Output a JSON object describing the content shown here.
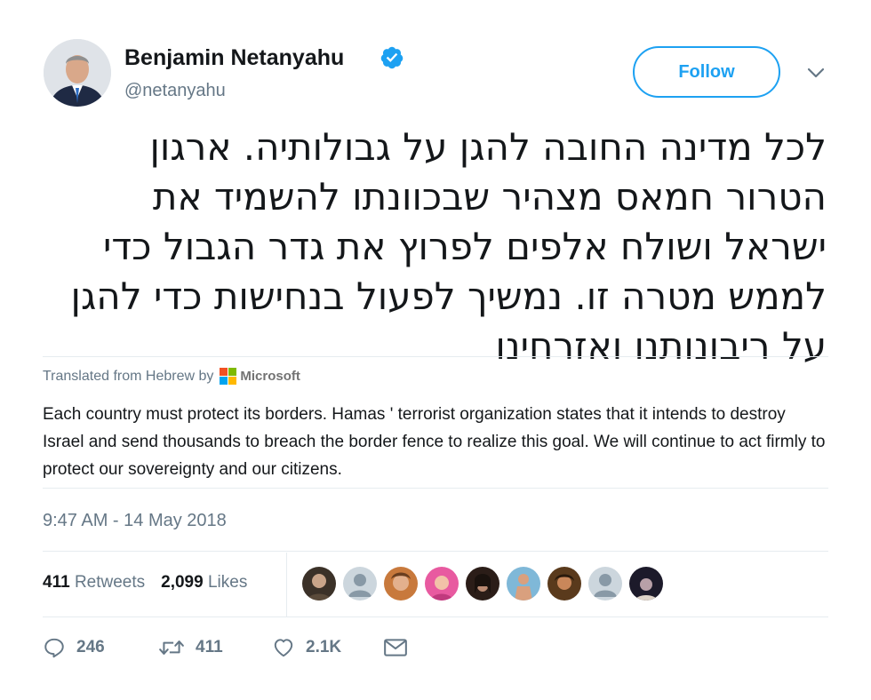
{
  "user": {
    "name": "Benjamin Netanyahu",
    "handle": "@netanyahu",
    "verified": true
  },
  "follow_label": "Follow",
  "tweet": {
    "hebrew_text": "לכל מדינה החובה להגן על גבולותיה. ארגון הטרור חמאס מצהיר שבכוונתו להשמיד את ישראל ושולח אלפים לפרוץ את גדר הגבול כדי לממש מטרה זו. נמשיך לפעול בנחישות כדי להגן על ריבונותנו ואזרחינו",
    "translated_from": "Translated from Hebrew by",
    "translator": "Microsoft",
    "translation": "Each country must protect its borders. Hamas ' terrorist organization states that it intends to destroy Israel and send thousands to breach the border fence to realize this goal. We will continue to act firmly to protect our sovereignty and our citizens.",
    "timestamp": "9:47 AM - 14 May 2018"
  },
  "stats": {
    "retweets_count": "411",
    "retweets_label": "Retweets",
    "likes_count": "2,099",
    "likes_label": "Likes"
  },
  "actions": {
    "replies": "246",
    "retweets": "411",
    "likes": "2.1K"
  },
  "colors": {
    "accent": "#1da1f2",
    "muted": "#657786",
    "text": "#14171a",
    "divider": "#e6ecf0"
  }
}
